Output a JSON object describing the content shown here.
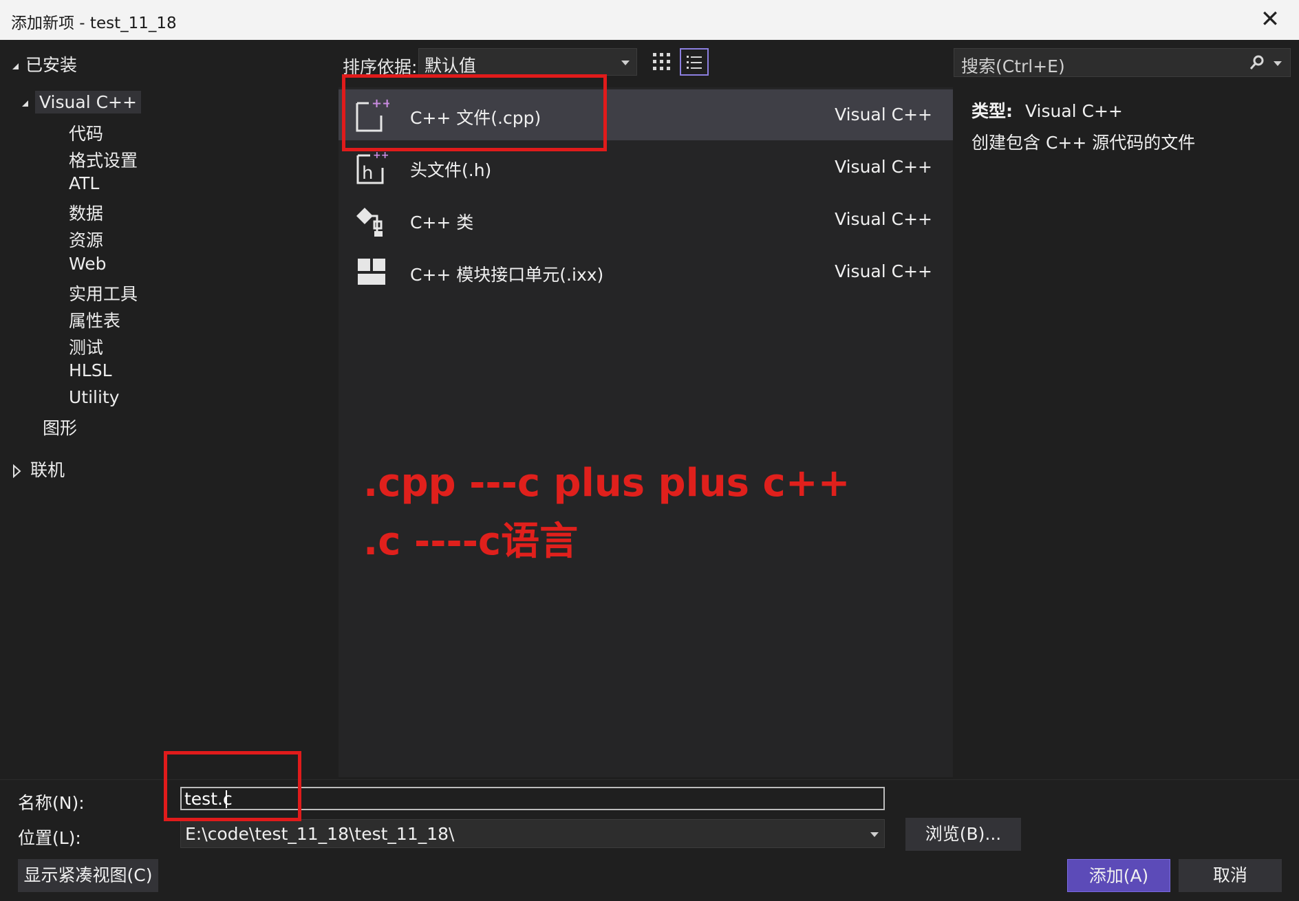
{
  "window": {
    "title": "添加新项 - test_11_18"
  },
  "tree": {
    "installed_label": "已安装",
    "visual_cpp_label": "Visual C++",
    "children": [
      "代码",
      "格式设置",
      "ATL",
      "数据",
      "资源",
      "Web",
      "实用工具",
      "属性表",
      "测试",
      "HLSL",
      "Utility"
    ],
    "graphics_label": "图形",
    "online_label": "联机"
  },
  "toolbar": {
    "sort_label": "排序依据:",
    "sort_value": "默认值"
  },
  "templates": [
    {
      "name": "C++ 文件(.cpp)",
      "lang": "Visual C++",
      "icon": "cpp-file-icon"
    },
    {
      "name": "头文件(.h)",
      "lang": "Visual C++",
      "icon": "header-file-icon"
    },
    {
      "name": "C++ 类",
      "lang": "Visual C++",
      "icon": "class-icon"
    },
    {
      "name": "C++ 模块接口单元(.ixx)",
      "lang": "Visual C++",
      "icon": "module-icon"
    }
  ],
  "search": {
    "placeholder": "搜索(Ctrl+E)"
  },
  "details": {
    "type_label": "类型:",
    "type_value": "Visual C++",
    "description": "创建包含 C++ 源代码的文件"
  },
  "annotation": {
    "line1": ".cpp  ---c plus plus  c++",
    "line2": ".c   ----c语言"
  },
  "form": {
    "name_label": "名称(N):",
    "name_value": "test.c",
    "location_label": "位置(L):",
    "location_value": "E:\\code\\test_11_18\\test_11_18\\",
    "browse_label": "浏览(B)..."
  },
  "buttons": {
    "compact_view": "显示紧凑视图(C)",
    "add": "添加(A)",
    "cancel": "取消"
  },
  "colors": {
    "accent": "#5c4bb8",
    "annotation_red": "#e01b1b",
    "background": "#1f1f1f",
    "selected_row": "#3f3f46"
  }
}
